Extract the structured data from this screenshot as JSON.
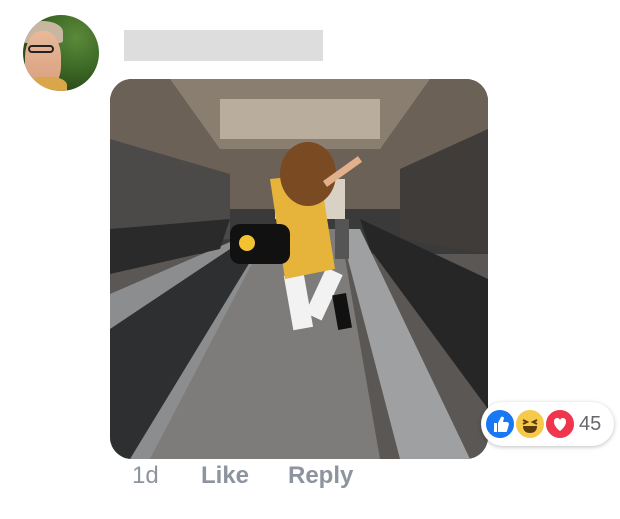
{
  "comment": {
    "author_avatar": "avatar",
    "timestamp": "1d",
    "actions": {
      "like_label": "Like",
      "reply_label": "Reply"
    },
    "reactions": {
      "icons": [
        "like-icon",
        "haha-icon",
        "love-icon"
      ],
      "count": "45"
    }
  },
  "colors": {
    "like_blue": "#1877f2",
    "haha_yellow": "#f7c94a",
    "love_red": "#f0364d",
    "action_gray": "#8d949e",
    "redacted_name": "#dddddd"
  }
}
